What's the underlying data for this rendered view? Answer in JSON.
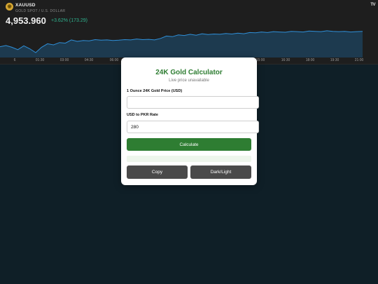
{
  "ticker": {
    "logo_glyph": "◉",
    "symbol": "XAUUSD",
    "subtitle": "GOLD SPOT / U.S. DOLLAR",
    "price": "4,953.960",
    "change": "+3.62% (173.29)",
    "up_color": "#2fb38f",
    "brand": "TV",
    "x_ticks": [
      "6",
      "01:30",
      "03:00",
      "04:30",
      "06:00",
      "15:00",
      "16:30",
      "18:00",
      "19:30",
      "21:00"
    ],
    "sparkline": [
      0.32,
      0.36,
      0.3,
      0.22,
      0.35,
      0.25,
      0.12,
      0.3,
      0.42,
      0.38,
      0.46,
      0.44,
      0.55,
      0.5,
      0.53,
      0.52,
      0.56,
      0.54,
      0.55,
      0.53,
      0.54,
      0.56,
      0.55,
      0.58,
      0.56,
      0.57,
      0.55,
      0.6,
      0.68,
      0.66,
      0.72,
      0.7,
      0.74,
      0.71,
      0.76,
      0.73,
      0.75,
      0.74,
      0.77,
      0.75,
      0.78,
      0.76,
      0.8,
      0.79,
      0.82,
      0.8,
      0.83,
      0.82,
      0.81,
      0.84,
      0.83,
      0.82,
      0.85,
      0.84,
      0.83,
      0.86,
      0.84,
      0.83,
      0.84,
      0.82,
      0.83,
      0.84
    ]
  },
  "calculator": {
    "title": "24K Gold Calculator",
    "status": "Live price unavailable",
    "gold_label": "1 Ounce 24K Gold Price (USD)",
    "gold_value": "",
    "rate_label": "USD to PKR Rate",
    "rate_value": "280",
    "calculate_label": "Calculate",
    "copy_label": "Copy",
    "theme_label": "Dark/Light",
    "accent": "#2e7d32"
  }
}
